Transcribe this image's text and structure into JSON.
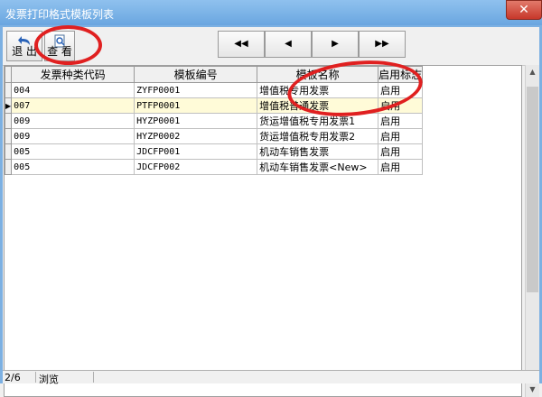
{
  "window": {
    "title": "发票打印格式模板列表",
    "close_glyph": "✕"
  },
  "toolbar": {
    "exit_label": "退 出",
    "view_label": "查 看"
  },
  "nav": {
    "first": "◀◀",
    "prev": "◀",
    "next": "▶",
    "last": "▶▶"
  },
  "table": {
    "columns": [
      "发票种类代码",
      "模板编号",
      "模板名称",
      "启用标志"
    ],
    "rows": [
      {
        "code": "004",
        "template_no": "ZYFP0001",
        "name": "增值税专用发票",
        "flag": "启用",
        "current": false
      },
      {
        "code": "007",
        "template_no": "PTFP0001",
        "name": "增值税普通发票",
        "flag": "启用",
        "current": true
      },
      {
        "code": "009",
        "template_no": "HYZP0001",
        "name": "货运增值税专用发票1",
        "flag": "启用",
        "current": false
      },
      {
        "code": "009",
        "template_no": "HYZP0002",
        "name": "货运增值税专用发票2",
        "flag": "启用",
        "current": false
      },
      {
        "code": "005",
        "template_no": "JDCFP001",
        "name": "机动车销售发票",
        "flag": "启用",
        "current": false
      },
      {
        "code": "005",
        "template_no": "JDCFP002",
        "name": "机动车销售发票<New>",
        "flag": "启用",
        "current": false
      }
    ]
  },
  "status": {
    "record": "2/6",
    "mode": "浏览"
  },
  "colors": {
    "title_bar": "#6aa6e0",
    "row_highlight": "#fffbd8",
    "annotation": "#e02020"
  }
}
